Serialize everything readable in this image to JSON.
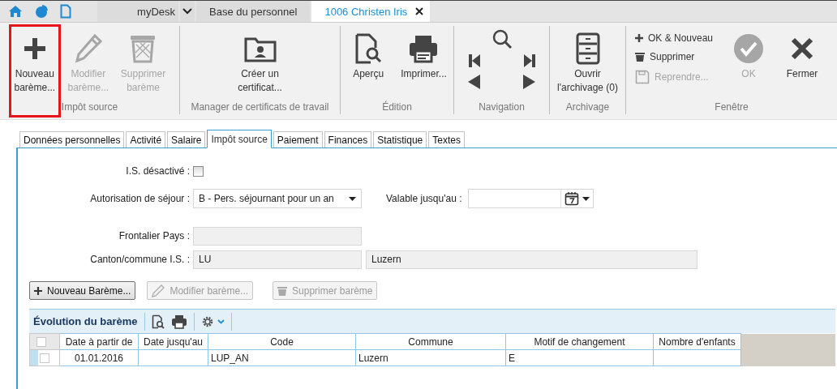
{
  "top_bar": {
    "desk": "myDesk",
    "tabs": [
      {
        "label": "Base du personnel",
        "selected": false,
        "closable": false
      },
      {
        "label": "1006 Christen Iris",
        "selected": true,
        "closable": true
      }
    ]
  },
  "ribbon": {
    "groups": [
      {
        "label": "Impôt source",
        "kind": "buttons",
        "items": [
          {
            "kind": "large",
            "label": "Nouveau\nbarème...",
            "disabled": false,
            "highlighted": true
          },
          {
            "kind": "large",
            "label": "Modifier\nbarème...",
            "disabled": true,
            "highlighted": false
          },
          {
            "kind": "large",
            "label": "Supprimer\nbarème",
            "disabled": true,
            "highlighted": false
          }
        ]
      },
      {
        "label": "Manager de certificats de travail",
        "kind": "buttons",
        "items": [
          {
            "kind": "large",
            "label": "Créer un\ncertificat...",
            "disabled": false,
            "highlighted": false
          }
        ]
      },
      {
        "label": "Édition",
        "kind": "buttons",
        "items": [
          {
            "kind": "large",
            "label": "Aperçu",
            "disabled": false,
            "highlighted": false
          },
          {
            "kind": "large",
            "label": "Imprimer...",
            "disabled": false,
            "highlighted": false
          }
        ]
      },
      {
        "label": "Navigation",
        "kind": "nav"
      },
      {
        "label": "Archivage",
        "kind": "buttons",
        "items": [
          {
            "kind": "large",
            "label": "Ouvrir\nl'archivage  (0)",
            "disabled": false,
            "highlighted": false
          }
        ]
      },
      {
        "label": "Fenêtre",
        "kind": "buttons",
        "items": [
          {
            "kind": "small",
            "label": "OK & Nouveau",
            "disabled": false,
            "highlighted": false
          },
          {
            "kind": "small",
            "label": "Supprimer",
            "disabled": false,
            "highlighted": false
          },
          {
            "kind": "small",
            "label": "Reprendre...",
            "disabled": true,
            "highlighted": false
          },
          {
            "kind": "large",
            "label": "OK",
            "disabled": true,
            "highlighted": false
          },
          {
            "kind": "large",
            "label": "Fermer",
            "disabled": false,
            "highlighted": false
          }
        ]
      }
    ]
  },
  "tabs": [
    {
      "label": "Données personnelles",
      "selected": false
    },
    {
      "label": "Activité",
      "selected": false
    },
    {
      "label": "Salaire",
      "selected": false
    },
    {
      "label": "Impôt source",
      "selected": true
    },
    {
      "label": "Paiement",
      "selected": false
    },
    {
      "label": "Finances",
      "selected": false
    },
    {
      "label": "Statistique",
      "selected": false
    },
    {
      "label": "Textes",
      "selected": false
    }
  ],
  "form": {
    "rows": [
      {
        "label": "I.S. désactivé :",
        "fields": [
          {
            "kind": "checkbox",
            "checked": false
          }
        ]
      },
      {
        "label": "Autorisation de séjour :",
        "fields": [
          {
            "kind": "select",
            "value": "B - Pers. séjournant pour un an"
          },
          {
            "kind": "date",
            "label": "Valable jusqu'au :"
          }
        ]
      },
      {
        "label": "Frontalier Pays :",
        "fields": [
          {
            "kind": "readonly"
          }
        ]
      },
      {
        "label": "Canton/commune I.S. :",
        "fields": [
          {
            "kind": "readonly",
            "value": "LU"
          },
          {
            "kind": "readonly_wide",
            "value": "Luzern"
          }
        ]
      }
    ]
  },
  "buttons": [
    {
      "label": "Nouveau Barème...",
      "disabled": false
    },
    {
      "label": "Modifier barème...",
      "disabled": true
    },
    {
      "label": "Supprimer barème",
      "disabled": true
    }
  ],
  "grid": {
    "title": "Évolution du barème",
    "header_checked": false,
    "columns": [
      "Date à partir de",
      "Date jusqu'au",
      "Code",
      "Commune",
      "Motif de changement",
      "Nombre d'enfants"
    ],
    "rows": [
      {
        "selected": true,
        "checked": false,
        "cells": [
          "01.01.2016",
          null,
          "LUP_AN",
          "Luzern",
          "E",
          null
        ]
      }
    ]
  }
}
